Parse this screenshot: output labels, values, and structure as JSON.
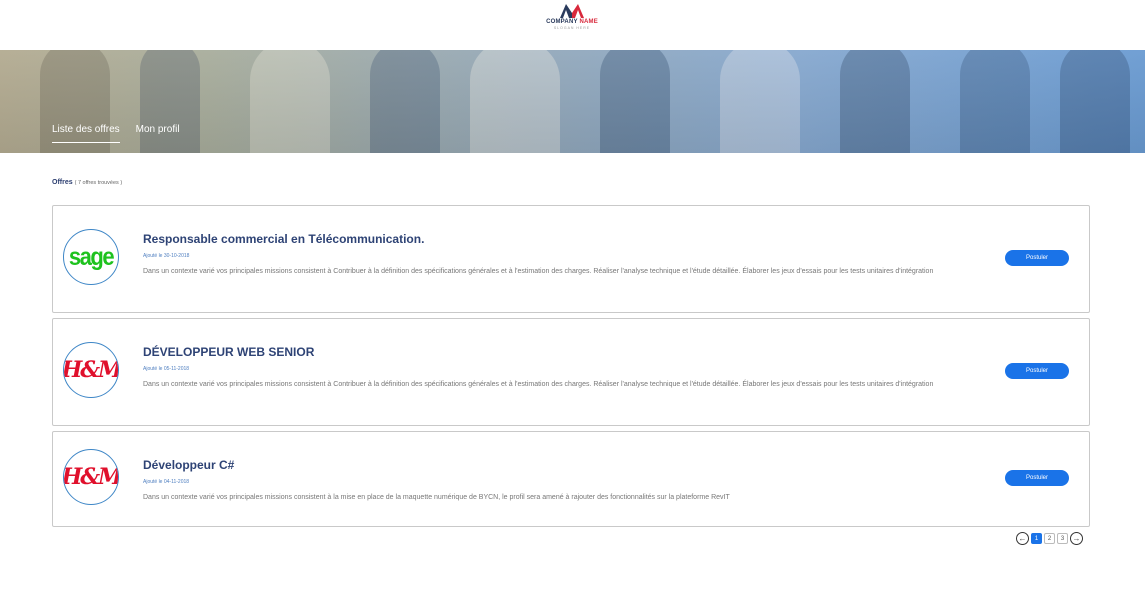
{
  "brand": {
    "name_part1": "COMPANY",
    "name_part2": "NAME",
    "slogan": "SLOGAN HERE",
    "logo_icon": "m-logo-icon"
  },
  "nav": {
    "items": [
      {
        "label": "Liste des offres",
        "active": true
      },
      {
        "label": "Mon profil",
        "active": false
      }
    ]
  },
  "results": {
    "label": "Offres",
    "count_text": "( 7 offres trouvées )"
  },
  "jobs": [
    {
      "logo": "sage",
      "logo_text": "sage",
      "title": "Responsable commercial en Télécommunication.",
      "date": "Ajouté le 30-10-2018",
      "description": "Dans un contexte varié vos principales missions consistent à Contribuer à la définition des spécifications générales et à l'estimation des charges. Réaliser l'analyse technique et l'étude détaillée. Élaborer les jeux d'essais pour les tests unitaires d'intégration",
      "apply_label": "Postuler"
    },
    {
      "logo": "hm",
      "logo_text": "H&M",
      "title": "DÉVELOPPEUR WEB SENIOR",
      "date": "Ajouté le 05-11-2018",
      "description": "Dans un contexte varié vos principales missions consistent à Contribuer à la définition des spécifications générales et à l'estimation des charges. Réaliser l'analyse technique et l'étude détaillée. Élaborer les jeux d'essais pour les tests unitaires d'intégration",
      "apply_label": "Postuler"
    },
    {
      "logo": "hm",
      "logo_text": "H&M",
      "title": "Développeur C#",
      "date": "Ajouté le 04-11-2018",
      "description": "Dans un contexte varié vos principales missions consistent à la mise en place de la maquette numérique de BYCN, le profil sera amené à rajouter des fonctionnalités sur la plateforme RevIT",
      "apply_label": "Postuler"
    }
  ],
  "pagination": {
    "prev_icon": "arrow-left-icon",
    "next_icon": "arrow-right-icon",
    "pages": [
      "1",
      "2",
      "3"
    ],
    "current": "1"
  },
  "colors": {
    "accent": "#1a73e8",
    "title": "#2e4375",
    "sage_green": "#1ec21e",
    "hm_red": "#e0102c"
  }
}
